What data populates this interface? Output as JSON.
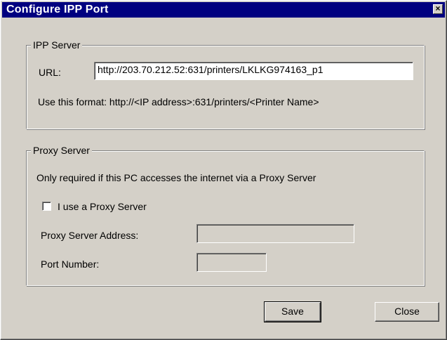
{
  "window": {
    "title": "Configure IPP Port",
    "close_glyph": "×"
  },
  "ipp_server": {
    "group_label": "IPP Server",
    "url_label": "URL:",
    "url_value": "http://203.70.212.52:631/printers/LKLKG974163_p1",
    "format_hint": "Use this format:  http://<IP address>:631/printers/<Printer Name>"
  },
  "proxy_server": {
    "group_label": "Proxy Server",
    "note": "Only required if this PC accesses the internet via a Proxy Server",
    "use_proxy_label": "I use a Proxy Server",
    "use_proxy_checked": false,
    "address_label": "Proxy Server Address:",
    "address_value": "",
    "port_label": "Port Number:",
    "port_value": ""
  },
  "buttons": {
    "save_label": "Save",
    "close_label": "Close"
  }
}
